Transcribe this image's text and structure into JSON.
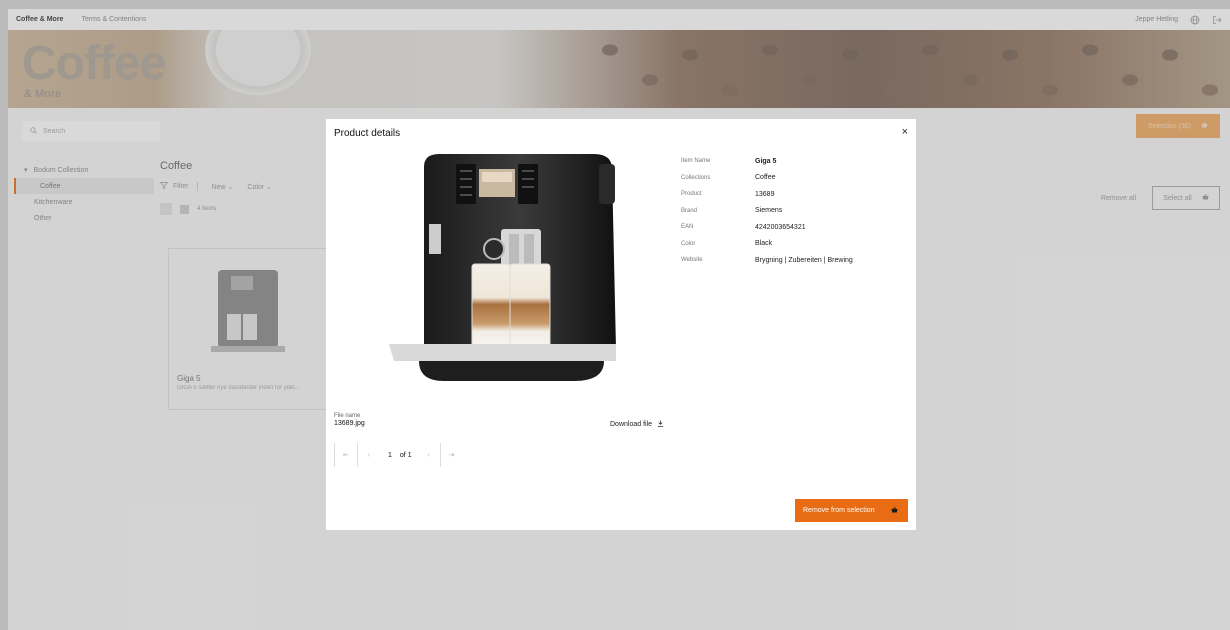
{
  "topnav": {
    "brand": "Coffee & More",
    "terms": "Terms & Contentions",
    "user": "Jeppe Hetling",
    "globe_icon": "globe-icon",
    "logout_icon": "logout-icon"
  },
  "hero": {
    "title": "Coffee",
    "subtitle": "& More"
  },
  "toolbar": {
    "search_placeholder": "Search",
    "selection_label": "Selection (36)"
  },
  "sidebar": {
    "items": [
      {
        "label": "Bodum Collection"
      },
      {
        "label": "Coffee"
      },
      {
        "label": "Kitchenware"
      },
      {
        "label": "Other"
      }
    ]
  },
  "content": {
    "title": "Coffee",
    "filter_label": "Filter",
    "new_label": "New",
    "color_label": "Color",
    "count": "4 items",
    "remove_all": "Remove all",
    "select_all": "Select all",
    "card": {
      "name": "Giga 5",
      "desc": "GIGA 5 sætter nye standarder inden for ydel..."
    }
  },
  "modal": {
    "title": "Product details",
    "close": "×",
    "details": [
      {
        "key": "Item Name",
        "value": "Giga 5"
      },
      {
        "key": "Collections",
        "value": "Coffee"
      },
      {
        "key": "Product",
        "value": "13689"
      },
      {
        "key": "Brand",
        "value": "Siemens"
      },
      {
        "key": "EAN",
        "value": "4242003654321"
      },
      {
        "key": "Color",
        "value": "Black"
      },
      {
        "key": "Website",
        "value": "Brygning | Zubereiten | Brewing"
      }
    ],
    "file_label": "File name",
    "file_name": "13689.jpg",
    "download_label": "Download file",
    "pager": {
      "current": "1",
      "of": "of 1"
    },
    "remove_label": "Remove from selection"
  },
  "colors": {
    "accent": "#e86c14",
    "accent_muted": "#f0a860"
  }
}
